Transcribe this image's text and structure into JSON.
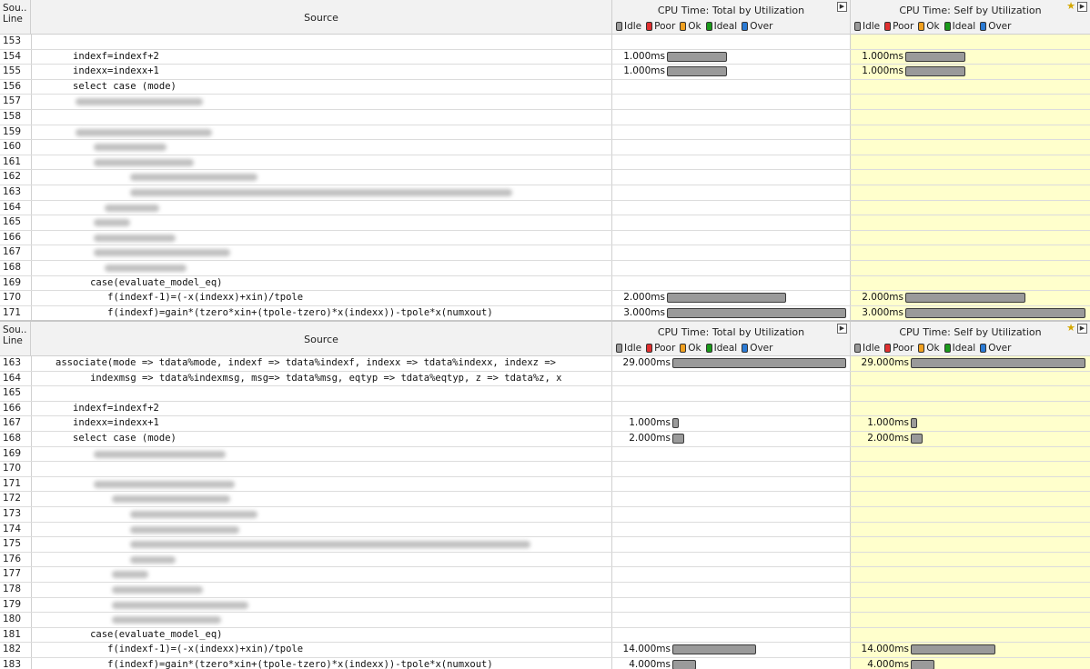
{
  "colors": {
    "idle": "#9a9a9a",
    "poor": "#e03030",
    "ok": "#f0a020",
    "ideal": "#1a9a1a",
    "over": "#2a7ad4",
    "self_bg": "#ffffcc"
  },
  "header": {
    "line_label": "Sou..\nLine",
    "source_label": "Source",
    "total_title": "CPU Time: Total by Utilization",
    "self_title": "CPU Time: Self by Utilization",
    "expand_icon": "expand-icon",
    "star_icon": "star-icon",
    "legend": [
      "Idle",
      "Poor",
      "Ok",
      "Ideal",
      "Over"
    ]
  },
  "pane1": {
    "max_ms": 3.0,
    "rows": [
      {
        "line": "153",
        "indent": 0,
        "code": "",
        "blur": [],
        "total": "",
        "self": "",
        "total_ms": 0,
        "self_ms": 0
      },
      {
        "line": "154",
        "indent": 3,
        "code": "indexf=indexf+2",
        "blur": [],
        "total": "1.000ms",
        "self": "1.000ms",
        "total_ms": 1,
        "self_ms": 1
      },
      {
        "line": "155",
        "indent": 3,
        "code": "indexx=indexx+1",
        "blur": [],
        "total": "1.000ms",
        "self": "1.000ms",
        "total_ms": 1,
        "self_ms": 1
      },
      {
        "line": "156",
        "indent": 3,
        "code": "select case (mode)",
        "blur": [],
        "total": "",
        "self": "",
        "total_ms": 0,
        "self_ms": 0
      },
      {
        "line": "157",
        "indent": 0,
        "code": "",
        "blur": [
          [
            48,
            140
          ]
        ],
        "total": "",
        "self": "",
        "total_ms": 0,
        "self_ms": 0
      },
      {
        "line": "158",
        "indent": 0,
        "code": "",
        "blur": [],
        "total": "",
        "self": "",
        "total_ms": 0,
        "self_ms": 0
      },
      {
        "line": "159",
        "indent": 0,
        "code": "",
        "blur": [
          [
            48,
            150
          ]
        ],
        "total": "",
        "self": "",
        "total_ms": 0,
        "self_ms": 0
      },
      {
        "line": "160",
        "indent": 0,
        "code": "",
        "blur": [
          [
            68,
            80
          ]
        ],
        "total": "",
        "self": "",
        "total_ms": 0,
        "self_ms": 0
      },
      {
        "line": "161",
        "indent": 0,
        "code": "",
        "blur": [
          [
            68,
            110
          ]
        ],
        "total": "",
        "self": "",
        "total_ms": 0,
        "self_ms": 0
      },
      {
        "line": "162",
        "indent": 0,
        "code": "",
        "blur": [
          [
            108,
            140
          ]
        ],
        "total": "",
        "self": "",
        "total_ms": 0,
        "self_ms": 0
      },
      {
        "line": "163",
        "indent": 0,
        "code": "",
        "blur": [
          [
            108,
            420
          ]
        ],
        "total": "",
        "self": "",
        "total_ms": 0,
        "self_ms": 0
      },
      {
        "line": "164",
        "indent": 0,
        "code": "",
        "blur": [
          [
            80,
            60
          ]
        ],
        "total": "",
        "self": "",
        "total_ms": 0,
        "self_ms": 0
      },
      {
        "line": "165",
        "indent": 0,
        "code": "",
        "blur": [
          [
            68,
            40
          ]
        ],
        "total": "",
        "self": "",
        "total_ms": 0,
        "self_ms": 0
      },
      {
        "line": "166",
        "indent": 0,
        "code": "",
        "blur": [
          [
            68,
            90
          ]
        ],
        "total": "",
        "self": "",
        "total_ms": 0,
        "self_ms": 0
      },
      {
        "line": "167",
        "indent": 0,
        "code": "",
        "blur": [
          [
            68,
            150
          ]
        ],
        "total": "",
        "self": "",
        "total_ms": 0,
        "self_ms": 0
      },
      {
        "line": "168",
        "indent": 0,
        "code": "",
        "blur": [
          [
            80,
            90
          ]
        ],
        "total": "",
        "self": "",
        "total_ms": 0,
        "self_ms": 0
      },
      {
        "line": "169",
        "indent": 6,
        "code": "case(evaluate_model_eq)",
        "blur": [],
        "total": "",
        "self": "",
        "total_ms": 0,
        "self_ms": 0
      },
      {
        "line": "170",
        "indent": 9,
        "code": "f(indexf-1)=(-x(indexx)+xin)/tpole",
        "blur": [],
        "total": "2.000ms",
        "self": "2.000ms",
        "total_ms": 2,
        "self_ms": 2
      },
      {
        "line": "171",
        "indent": 9,
        "code": "f(indexf)=gain*(tzero*xin+(tpole-tzero)*x(indexx))-tpole*x(numxout)",
        "blur": [],
        "total": "3.000ms",
        "self": "3.000ms",
        "total_ms": 3,
        "self_ms": 3
      }
    ]
  },
  "pane2": {
    "max_ms": 29.0,
    "rows": [
      {
        "line": "163",
        "indent": 0,
        "code": "associate(mode => tdata%mode, indexf => tdata%indexf, indexx => tdata%indexx, indexz =>",
        "blur": [],
        "total": "29.000ms",
        "self": "29.000ms",
        "total_ms": 29,
        "self_ms": 29
      },
      {
        "line": "164",
        "indent": 6,
        "code": "indexmsg => tdata%indexmsg, msg=> tdata%msg, eqtyp => tdata%eqtyp, z => tdata%z, x",
        "blur": [],
        "total": "",
        "self": "",
        "total_ms": 0,
        "self_ms": 0
      },
      {
        "line": "165",
        "indent": 0,
        "code": "",
        "blur": [],
        "total": "",
        "self": "",
        "total_ms": 0,
        "self_ms": 0
      },
      {
        "line": "166",
        "indent": 3,
        "code": "indexf=indexf+2",
        "blur": [],
        "total": "",
        "self": "",
        "total_ms": 0,
        "self_ms": 0
      },
      {
        "line": "167",
        "indent": 3,
        "code": "indexx=indexx+1",
        "blur": [],
        "total": "1.000ms",
        "self": "1.000ms",
        "total_ms": 1,
        "self_ms": 1
      },
      {
        "line": "168",
        "indent": 3,
        "code": "select case (mode)",
        "blur": [],
        "total": "2.000ms",
        "self": "2.000ms",
        "total_ms": 2,
        "self_ms": 2
      },
      {
        "line": "169",
        "indent": 0,
        "code": "",
        "blur": [
          [
            68,
            145
          ]
        ],
        "total": "",
        "self": "",
        "total_ms": 0,
        "self_ms": 0
      },
      {
        "line": "170",
        "indent": 0,
        "code": "",
        "blur": [],
        "total": "",
        "self": "",
        "total_ms": 0,
        "self_ms": 0
      },
      {
        "line": "171",
        "indent": 0,
        "code": "",
        "blur": [
          [
            68,
            155
          ]
        ],
        "total": "",
        "self": "",
        "total_ms": 0,
        "self_ms": 0
      },
      {
        "line": "172",
        "indent": 0,
        "code": "",
        "blur": [
          [
            88,
            130
          ]
        ],
        "total": "",
        "self": "",
        "total_ms": 0,
        "self_ms": 0
      },
      {
        "line": "173",
        "indent": 0,
        "code": "",
        "blur": [
          [
            108,
            140
          ]
        ],
        "total": "",
        "self": "",
        "total_ms": 0,
        "self_ms": 0
      },
      {
        "line": "174",
        "indent": 0,
        "code": "",
        "blur": [
          [
            108,
            120
          ]
        ],
        "total": "",
        "self": "",
        "total_ms": 0,
        "self_ms": 0
      },
      {
        "line": "175",
        "indent": 0,
        "code": "",
        "blur": [
          [
            108,
            440
          ]
        ],
        "total": "",
        "self": "",
        "total_ms": 0,
        "self_ms": 0
      },
      {
        "line": "176",
        "indent": 0,
        "code": "",
        "blur": [
          [
            108,
            50
          ]
        ],
        "total": "",
        "self": "",
        "total_ms": 0,
        "self_ms": 0
      },
      {
        "line": "177",
        "indent": 0,
        "code": "",
        "blur": [
          [
            88,
            40
          ]
        ],
        "total": "",
        "self": "",
        "total_ms": 0,
        "self_ms": 0
      },
      {
        "line": "178",
        "indent": 0,
        "code": "",
        "blur": [
          [
            88,
            100
          ]
        ],
        "total": "",
        "self": "",
        "total_ms": 0,
        "self_ms": 0
      },
      {
        "line": "179",
        "indent": 0,
        "code": "",
        "blur": [
          [
            88,
            150
          ]
        ],
        "total": "",
        "self": "",
        "total_ms": 0,
        "self_ms": 0
      },
      {
        "line": "180",
        "indent": 0,
        "code": "",
        "blur": [
          [
            88,
            120
          ]
        ],
        "total": "",
        "self": "",
        "total_ms": 0,
        "self_ms": 0
      },
      {
        "line": "181",
        "indent": 6,
        "code": "case(evaluate_model_eq)",
        "blur": [],
        "total": "",
        "self": "",
        "total_ms": 0,
        "self_ms": 0
      },
      {
        "line": "182",
        "indent": 9,
        "code": "f(indexf-1)=(-x(indexx)+xin)/tpole",
        "blur": [],
        "total": "14.000ms",
        "self": "14.000ms",
        "total_ms": 14,
        "self_ms": 14
      },
      {
        "line": "183",
        "indent": 9,
        "code": "f(indexf)=gain*(tzero*xin+(tpole-tzero)*x(indexx))-tpole*x(numxout)",
        "blur": [],
        "total": "4.000ms",
        "self": "4.000ms",
        "total_ms": 4,
        "self_ms": 4
      }
    ]
  }
}
